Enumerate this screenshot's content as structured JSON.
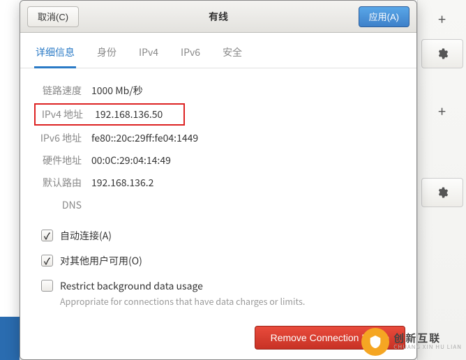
{
  "titlebar": {
    "cancel_label": "取消(C)",
    "title": "有线",
    "apply_label": "应用(A)"
  },
  "tabs": [
    {
      "label": "详细信息",
      "active": true
    },
    {
      "label": "身份",
      "active": false
    },
    {
      "label": "IPv4",
      "active": false
    },
    {
      "label": "IPv6",
      "active": false
    },
    {
      "label": "安全",
      "active": false
    }
  ],
  "details": {
    "link_speed_label": "链路速度",
    "link_speed_value": "1000 Mb/秒",
    "ipv4_label": "IPv4 地址",
    "ipv4_value": "192.168.136.50",
    "ipv6_label": "IPv6 地址",
    "ipv6_value": "fe80::20c:29ff:fe04:1449",
    "hw_label": "硬件地址",
    "hw_value": "00:0C:29:04:14:49",
    "route_label": "默认路由",
    "route_value": "192.168.136.2",
    "dns_label": "DNS",
    "dns_value": ""
  },
  "options": {
    "auto_connect_label": "自动连接(A)",
    "available_all_label": "对其他用户可用(O)",
    "restrict_label": "Restrict background data usage",
    "restrict_sub": "Appropriate for connections that have data charges or limits."
  },
  "footer": {
    "remove_label": "Remove Connection Profile"
  },
  "watermark": {
    "cn": "创新互联",
    "en": "CHUANG XIN HU LIAN"
  }
}
